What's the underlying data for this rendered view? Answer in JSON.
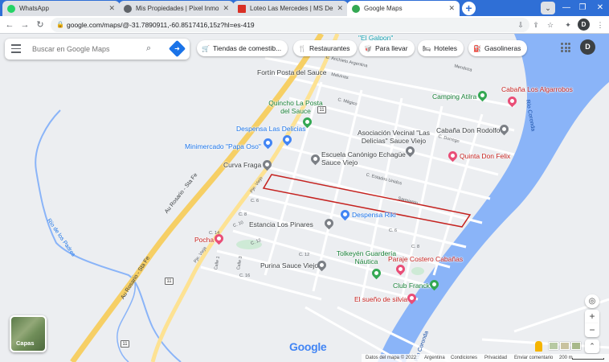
{
  "tabs": [
    {
      "title": "WhatsApp",
      "favicon_color": "#25d366",
      "active": false
    },
    {
      "title": "Mis Propiedades | Pixel Inmobilia",
      "favicon_color": "#5f6368",
      "active": false
    },
    {
      "title": "Loteo Las Mercedes | MS Desarr",
      "favicon_color": "#d93025",
      "active": false
    },
    {
      "title": "Google Maps",
      "favicon_color": "#34a853",
      "active": true
    }
  ],
  "address_bar": {
    "url": "google.com/maps/@-31.7890911,-60.8517416,15z?hl=es-419",
    "profile_initial": "D"
  },
  "search": {
    "placeholder": "Buscar en Google Maps"
  },
  "chips": [
    {
      "label": "Tiendas de comestib...",
      "icon": "cart-icon"
    },
    {
      "label": "Restaurantes",
      "icon": "fork-knife-icon"
    },
    {
      "label": "Para llevar",
      "icon": "takeout-icon"
    },
    {
      "label": "Hoteles",
      "icon": "bed-icon"
    },
    {
      "label": "Gasolineras",
      "icon": "fuel-icon"
    }
  ],
  "map_profile_initial": "D",
  "places": {
    "galpon": "\"El Galpon\"",
    "fortin": "Fortín Posta del Sauce",
    "quincho": "Quincho La Posta del Sauce",
    "cabana_alg": "Cabaña Los Algarrobos",
    "camping": "Camping Atilra",
    "despensa_del": "Despensa Las Delicias",
    "asoc": "Asociación Vecinal \"Las Delicias\" Sauce Viejo",
    "cabana_rod": "Cabaña Don Rodolfo",
    "minimercado": "Minimercado \"Papa Oso\"",
    "escuela": "Escuela Canónigo Echagüe Sauce Viejo",
    "quinta": "Quinta Don Felix",
    "curva": "Curva Fraga",
    "despensa_riki": "Despensa Riki",
    "estancia": "Estancia Los Pinares",
    "pocha": "Pocha",
    "tolkeyen": "Tolkeyén Guardería Náutica",
    "paraje": "Paraje Costero Cabañas",
    "purina": "Purina Sauce Viejo",
    "club": "Club Franck",
    "sueno": "El sueño de silvia"
  },
  "roads": {
    "au_rosario_1": "Au Rosario - Sta Fe",
    "au_rosario_2": "Au Rosario - Sta Fe",
    "rio_padres": "Río de los Padres",
    "rio_coronda": "Río Coronda",
    "rio_coronda_2": "Río Coronda",
    "route_11": "11",
    "malvinas": "Malvinas",
    "ancieto": "C. Anchieto Argentina",
    "mendoza": "Mendoza",
    "magico": "C. Mágico",
    "dorrego": "C. Dorrego",
    "estados": "C. Estados Unidos",
    "sarmiento": "Sarmiento",
    "viejo": "Pje. Viejo",
    "c6": "C. 6",
    "c8": "C. 8",
    "c10": "C. 10",
    "c12": "C. 12",
    "c14": "C. 14",
    "c16": "C. 16",
    "calle1": "Calle 1",
    "calle3": "Calle 3",
    "pje_vieja": "Pje. Vieja"
  },
  "controls": {
    "layers_label": "Capas",
    "zoom_in": "+",
    "zoom_out": "−"
  },
  "footer": {
    "google_logo": "Google",
    "map_data": "Datos del mapa © 2022",
    "country": "Argentina",
    "terms": "Condiciones",
    "privacy": "Privacidad",
    "feedback": "Enviar comentario",
    "scale": "200 m"
  }
}
